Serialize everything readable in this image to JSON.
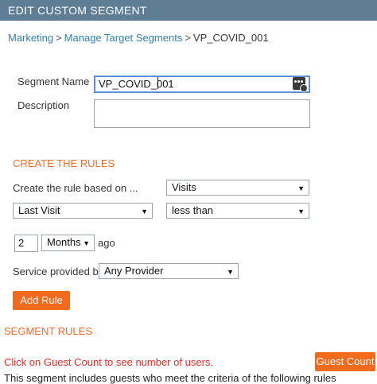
{
  "header": {
    "title": "EDIT CUSTOM SEGMENT"
  },
  "breadcrumb": {
    "items": [
      "Marketing",
      "Manage Target Segments"
    ],
    "separator": ">",
    "current": "VP_COVID_001"
  },
  "form": {
    "segment_name_label": "Segment Name",
    "segment_name_value": "VP_COVID_001",
    "description_label": "Description",
    "description_value": ""
  },
  "rules": {
    "section_title": "CREATE THE RULES",
    "based_on_label": "Create the rule based on ...",
    "based_on_value": "Visits",
    "field_value": "Last Visit",
    "operator_value": "less than",
    "amount_value": "2",
    "unit_value": "Months",
    "unit_suffix": "ago",
    "service_label": "Service provided by",
    "service_value": "Any Provider",
    "add_rule_label": "Add Rule"
  },
  "segment_rules": {
    "section_title": "SEGMENT RULES",
    "guest_count_note": "Click on Guest Count to see number of users.",
    "guest_count_button": "Guest Count",
    "criteria_note": "This segment includes guests who meet the criteria of the following rules"
  },
  "colors": {
    "header_bg": "#5f7e95",
    "accent_orange": "#f26a1b",
    "link_blue": "#2f7fb0",
    "warning_red": "#e03027"
  },
  "icons": {
    "password_manager": "lastpass-icon",
    "dropdown": "chevron-down-icon"
  }
}
